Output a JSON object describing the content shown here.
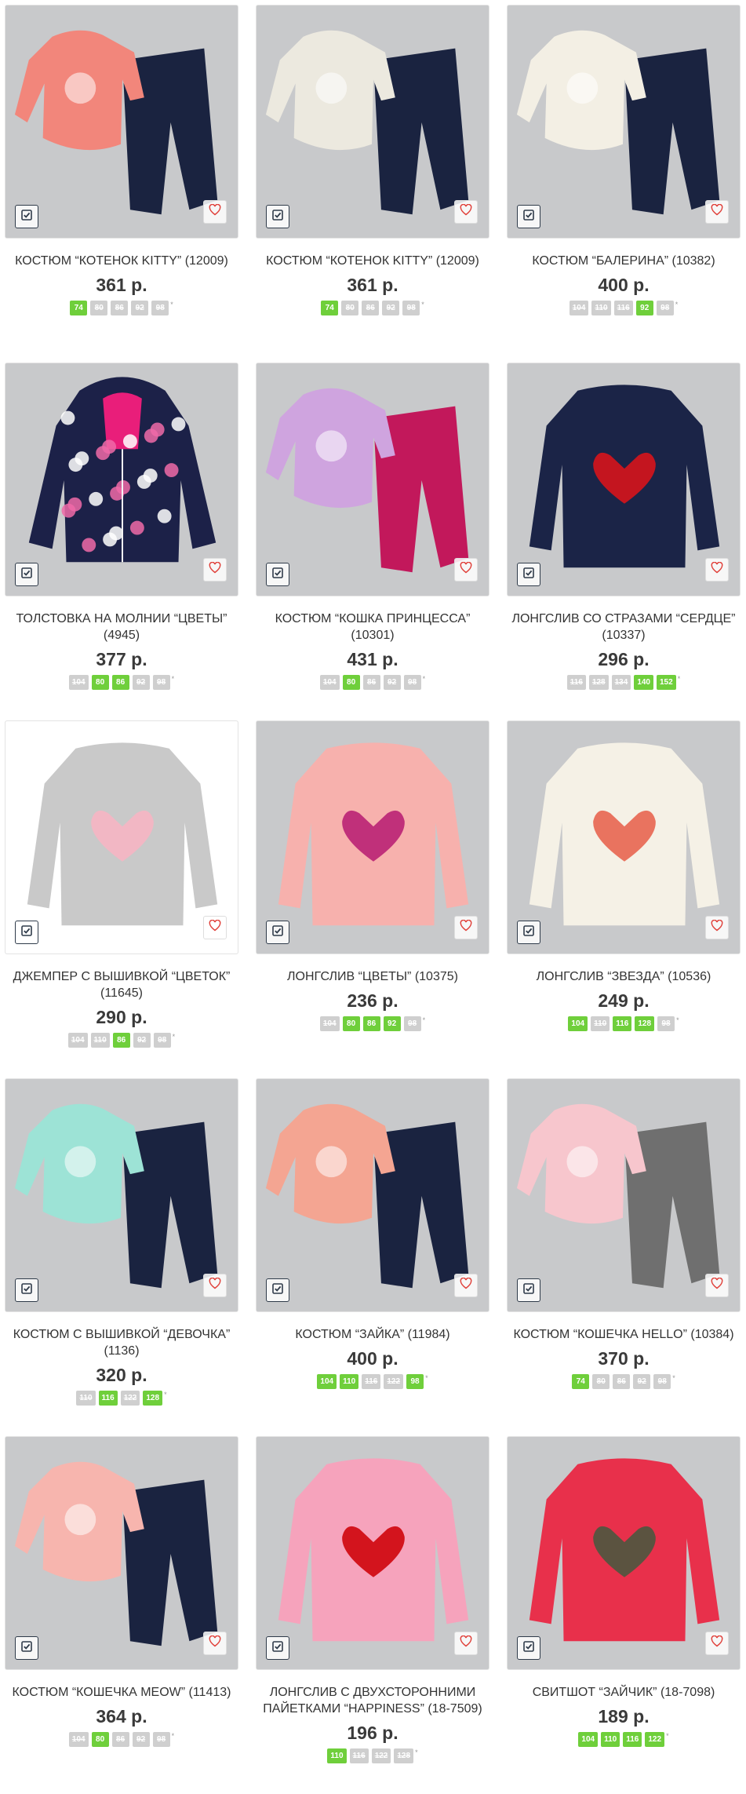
{
  "colors": {
    "available": "#6fcf3b",
    "unavailable": "#cfcfcf",
    "heart": "#e0403a"
  },
  "icons": {
    "compare": "checkbox-compare-icon",
    "favorite": "heart-icon"
  },
  "products": [
    {
      "title": "КОСТЮМ “КОТЕНОК KITTY” (12009)",
      "price": "361 р.",
      "sizes": [
        {
          "label": "74",
          "available": true
        },
        {
          "label": "80",
          "available": false
        },
        {
          "label": "86",
          "available": false
        },
        {
          "label": "92",
          "available": false
        },
        {
          "label": "98",
          "available": false
        }
      ],
      "photo": {
        "bg": "#c8c9cb",
        "top": "#f2867b",
        "bottom": "#1a2340",
        "kind": "set"
      }
    },
    {
      "title": "КОСТЮМ “КОТЕНОК KITTY” (12009)",
      "price": "361 р.",
      "sizes": [
        {
          "label": "74",
          "available": true
        },
        {
          "label": "80",
          "available": false
        },
        {
          "label": "86",
          "available": false
        },
        {
          "label": "92",
          "available": false
        },
        {
          "label": "98",
          "available": false
        }
      ],
      "photo": {
        "bg": "#c8c9cb",
        "top": "#ece9df",
        "bottom": "#1a2340",
        "kind": "set"
      }
    },
    {
      "title": "КОСТЮМ “БАЛЕРИНА” (10382)",
      "price": "400 р.",
      "sizes": [
        {
          "label": "104",
          "available": false
        },
        {
          "label": "110",
          "available": false
        },
        {
          "label": "116",
          "available": false
        },
        {
          "label": "92",
          "available": true
        },
        {
          "label": "98",
          "available": false
        }
      ],
      "photo": {
        "bg": "#c8c9cb",
        "top": "#f3efe4",
        "bottom": "#1a2340",
        "kind": "set"
      }
    },
    {
      "title": "ТОЛСТОВКА НА МОЛНИИ “ЦВЕТЫ” (4945)",
      "price": "377 р.",
      "sizes": [
        {
          "label": "104",
          "available": false
        },
        {
          "label": "80",
          "available": true
        },
        {
          "label": "86",
          "available": true
        },
        {
          "label": "92",
          "available": false
        },
        {
          "label": "98",
          "available": false
        }
      ],
      "photo": {
        "bg": "#c8c9cb",
        "top": "#1c2148",
        "bottom": "",
        "kind": "hoodie"
      }
    },
    {
      "title": "КОСТЮМ “КОШКА ПРИНЦЕССА” (10301)",
      "price": "431 р.",
      "sizes": [
        {
          "label": "104",
          "available": false
        },
        {
          "label": "80",
          "available": true
        },
        {
          "label": "86",
          "available": false
        },
        {
          "label": "92",
          "available": false
        },
        {
          "label": "98",
          "available": false
        }
      ],
      "photo": {
        "bg": "#c8c9cb",
        "top": "#cfa4df",
        "bottom": "#c2185b",
        "kind": "set"
      }
    },
    {
      "title": "ЛОНГСЛИВ СО СТРАЗАМИ “СЕРДЦЕ” (10337)",
      "price": "296 р.",
      "sizes": [
        {
          "label": "116",
          "available": false
        },
        {
          "label": "128",
          "available": false
        },
        {
          "label": "134",
          "available": false
        },
        {
          "label": "140",
          "available": true
        },
        {
          "label": "152",
          "available": true
        }
      ],
      "photo": {
        "bg": "#c8c9cb",
        "top": "#1b2447",
        "bottom": "",
        "kind": "top",
        "accent": "#c4151f"
      }
    },
    {
      "title": "ДЖЕМПЕР С ВЫШИВКОЙ “ЦВЕТОК” (11645)",
      "price": "290 р.",
      "sizes": [
        {
          "label": "104",
          "available": false
        },
        {
          "label": "110",
          "available": false
        },
        {
          "label": "86",
          "available": true
        },
        {
          "label": "92",
          "available": false
        },
        {
          "label": "98",
          "available": false
        }
      ],
      "photo": {
        "bg": "#ffffff",
        "top": "#c9c9c9",
        "bottom": "",
        "kind": "top",
        "accent": "#f2b7c4"
      }
    },
    {
      "title": "ЛОНГСЛИВ “ЦВЕТЫ” (10375)",
      "price": "236 р.",
      "sizes": [
        {
          "label": "104",
          "available": false
        },
        {
          "label": "80",
          "available": true
        },
        {
          "label": "86",
          "available": true
        },
        {
          "label": "92",
          "available": true
        },
        {
          "label": "98",
          "available": false
        }
      ],
      "photo": {
        "bg": "#c8c9cb",
        "top": "#f7b1ad",
        "bottom": "",
        "kind": "top",
        "accent": "#c0307a"
      }
    },
    {
      "title": "ЛОНГСЛИВ “ЗВЕЗДА” (10536)",
      "price": "249 р.",
      "sizes": [
        {
          "label": "104",
          "available": true
        },
        {
          "label": "110",
          "available": false
        },
        {
          "label": "116",
          "available": true
        },
        {
          "label": "128",
          "available": true
        },
        {
          "label": "98",
          "available": false
        }
      ],
      "photo": {
        "bg": "#c8c9cb",
        "top": "#f5f1e6",
        "bottom": "",
        "kind": "top",
        "accent": "#e9735f"
      }
    },
    {
      "title": "КОСТЮМ С ВЫШИВКОЙ “ДЕВОЧКА” (1136)",
      "price": "320 р.",
      "sizes": [
        {
          "label": "110",
          "available": false
        },
        {
          "label": "116",
          "available": true
        },
        {
          "label": "122",
          "available": false
        },
        {
          "label": "128",
          "available": true
        }
      ],
      "photo": {
        "bg": "#c8c9cb",
        "top": "#9de3d6",
        "bottom": "#1a2340",
        "kind": "set"
      }
    },
    {
      "title": "КОСТЮМ “ЗАЙКА” (11984)",
      "price": "400 р.",
      "sizes": [
        {
          "label": "104",
          "available": true
        },
        {
          "label": "110",
          "available": true
        },
        {
          "label": "116",
          "available": false
        },
        {
          "label": "122",
          "available": false
        },
        {
          "label": "98",
          "available": true
        }
      ],
      "photo": {
        "bg": "#c8c9cb",
        "top": "#f4a592",
        "bottom": "#1a2340",
        "kind": "set"
      }
    },
    {
      "title": "КОСТЮМ “КОШЕЧКА HELLO” (10384)",
      "price": "370 р.",
      "sizes": [
        {
          "label": "74",
          "available": true
        },
        {
          "label": "80",
          "available": false
        },
        {
          "label": "86",
          "available": false
        },
        {
          "label": "92",
          "available": false
        },
        {
          "label": "98",
          "available": false
        }
      ],
      "photo": {
        "bg": "#c8c9cb",
        "top": "#f7c6cd",
        "bottom": "#6f6f6f",
        "kind": "set"
      }
    },
    {
      "title": "КОСТЮМ “КОШЕЧКА MEOW” (11413)",
      "price": "364 р.",
      "sizes": [
        {
          "label": "104",
          "available": false
        },
        {
          "label": "80",
          "available": true
        },
        {
          "label": "86",
          "available": false
        },
        {
          "label": "92",
          "available": false
        },
        {
          "label": "98",
          "available": false
        }
      ],
      "photo": {
        "bg": "#c8c9cb",
        "top": "#f7b5ae",
        "bottom": "#1a2340",
        "kind": "set"
      }
    },
    {
      "title": "ЛОНГСЛИВ С ДВУХСТОРОННИМИ ПАЙЕТКАМИ “HAPPINESS” (18-7509)",
      "price": "196 р.",
      "sizes": [
        {
          "label": "110",
          "available": true
        },
        {
          "label": "116",
          "available": false
        },
        {
          "label": "122",
          "available": false
        },
        {
          "label": "128",
          "available": false
        }
      ],
      "photo": {
        "bg": "#c8c9cb",
        "top": "#f6a3bc",
        "bottom": "",
        "kind": "top",
        "accent": "#d3141d"
      }
    },
    {
      "title": "СВИТШОТ “ЗАЙЧИК” (18-7098)",
      "price": "189 р.",
      "sizes": [
        {
          "label": "104",
          "available": true
        },
        {
          "label": "110",
          "available": true
        },
        {
          "label": "116",
          "available": true
        },
        {
          "label": "122",
          "available": true
        }
      ],
      "photo": {
        "bg": "#c8c9cb",
        "top": "#e8304b",
        "bottom": "",
        "kind": "top",
        "accent": "#5b5340"
      }
    }
  ]
}
